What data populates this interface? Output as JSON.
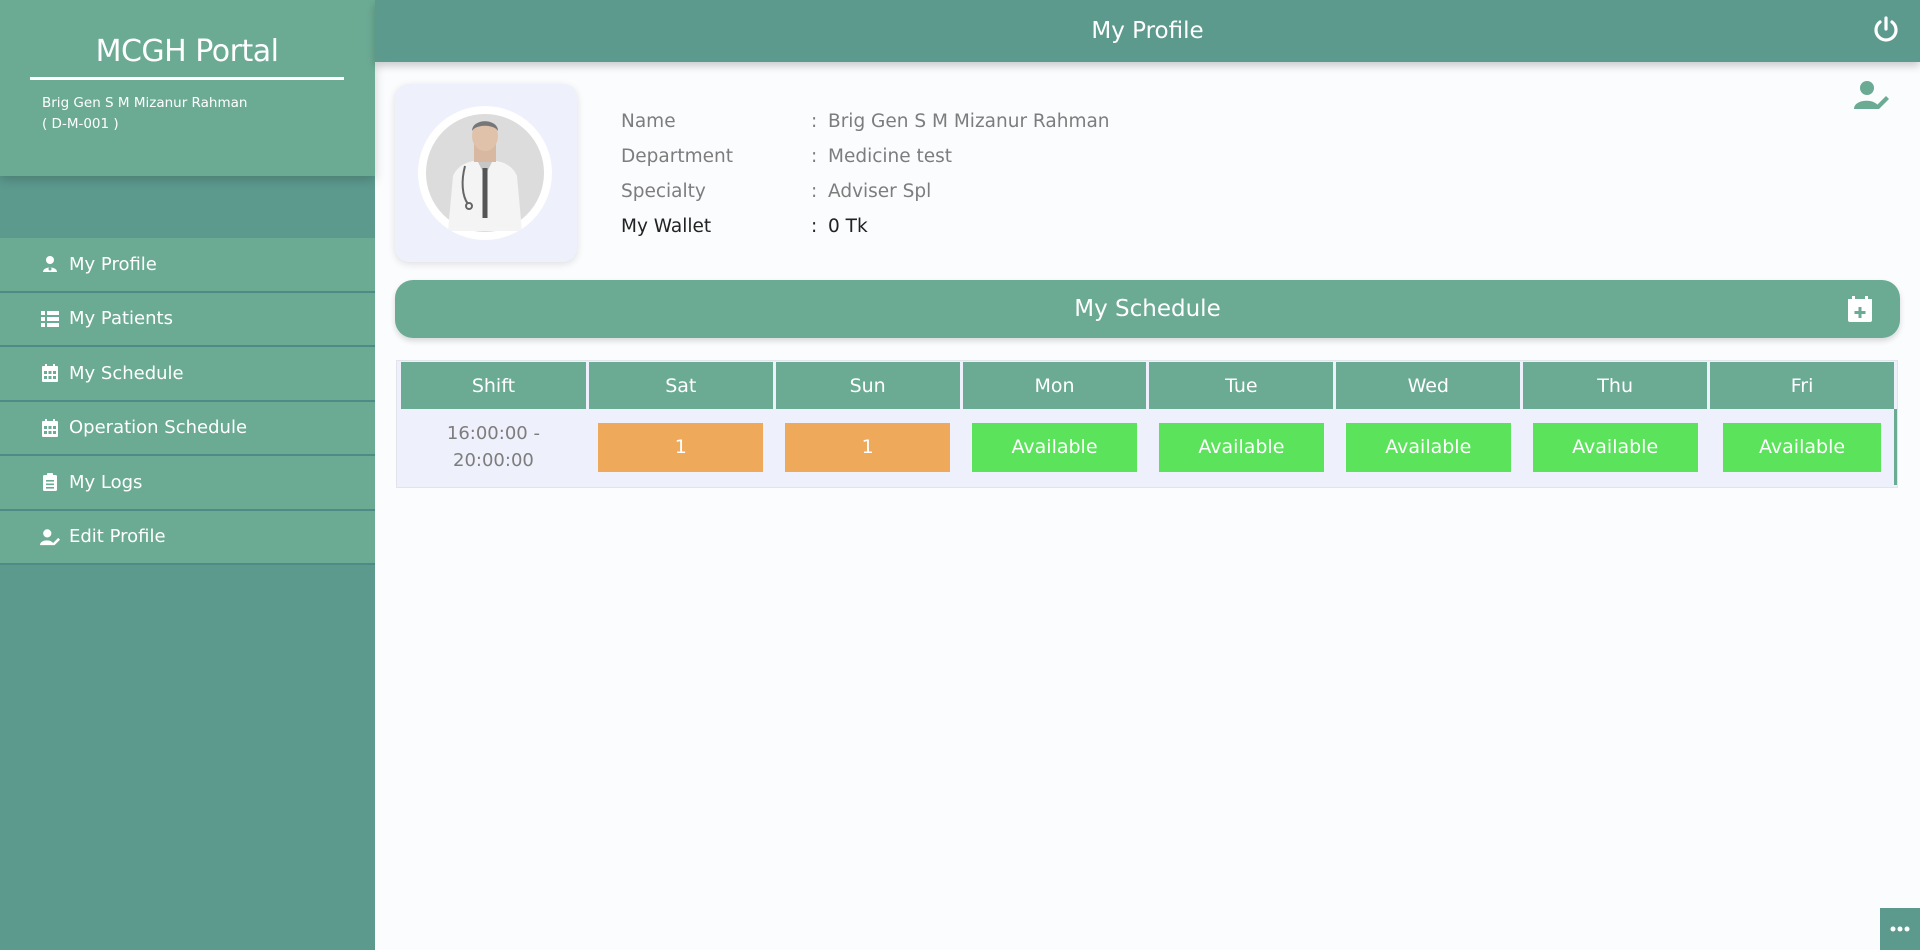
{
  "sidebar": {
    "brand": "MCGH Portal",
    "user_name": "Brig Gen S M Mizanur Rahman",
    "user_id": "( D-M-001 )",
    "items": [
      {
        "label": "My Profile",
        "icon": "user-md-icon"
      },
      {
        "label": "My Patients",
        "icon": "list-icon"
      },
      {
        "label": "My Schedule",
        "icon": "calendar-icon"
      },
      {
        "label": "Operation Schedule",
        "icon": "calendar-icon"
      },
      {
        "label": "My Logs",
        "icon": "clipboard-icon"
      },
      {
        "label": "Edit Profile",
        "icon": "user-edit-icon"
      }
    ]
  },
  "header": {
    "title": "My Profile",
    "power_icon": "power-icon"
  },
  "profile": {
    "rows": [
      {
        "key": "Name",
        "sep": ":",
        "value": "Brig Gen S M Mizanur Rahman"
      },
      {
        "key": "Department",
        "sep": ":",
        "value": "Medicine test"
      },
      {
        "key": "Specialty",
        "sep": ":",
        "value": "Adviser Spl"
      },
      {
        "key": "My Wallet",
        "sep": ":",
        "value": "0 Tk"
      }
    ]
  },
  "schedule": {
    "title": "My Schedule",
    "columns": [
      "Shift",
      "Sat",
      "Sun",
      "Mon",
      "Tue",
      "Wed",
      "Thu",
      "Fri"
    ],
    "rows": [
      {
        "shift_line1": "16:00:00 -",
        "shift_line2": "20:00:00",
        "cells": [
          "1",
          "1",
          "Available",
          "Available",
          "Available",
          "Available",
          "Available"
        ]
      }
    ]
  },
  "colors": {
    "sidebar": "#5c9a8e",
    "accent": "#6bab94",
    "booked": "#eea95b",
    "available": "#5ce35c"
  }
}
